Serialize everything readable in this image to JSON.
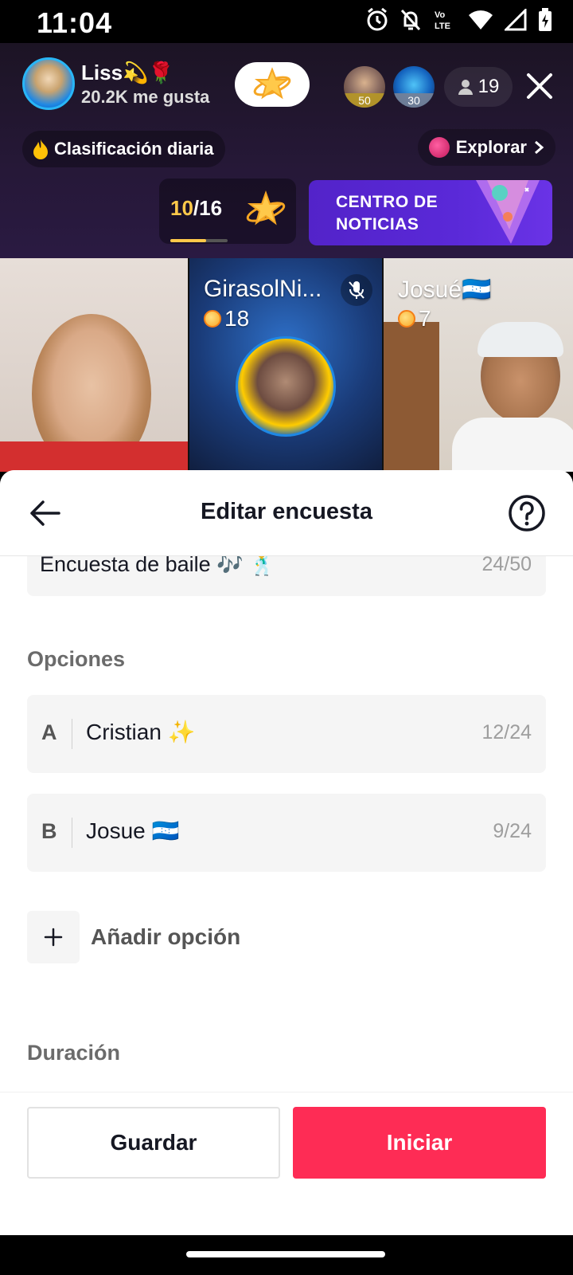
{
  "status_bar": {
    "time": "11:04",
    "network_label": "Vo LTE",
    "icons": [
      "alarm-icon",
      "notifications-off-icon",
      "volte-icon",
      "wifi-icon",
      "signal-icon",
      "battery-charging-icon"
    ]
  },
  "live": {
    "host_name": "Liss💫🌹",
    "host_likes": "20.2K me gusta",
    "top_viewers": [
      {
        "badge": "50"
      },
      {
        "badge": "30"
      }
    ],
    "viewer_count": "19",
    "daily_rank_label": "Clasificación diaria",
    "explore_label": "Explorar",
    "progress_current": "10",
    "progress_total": "/16",
    "progress_fraction": 0.625,
    "news_banner_text": "CENTRO DE NOTICIAS"
  },
  "guests": [
    {
      "name": "",
      "coins": ""
    },
    {
      "name": "GirasolNi...",
      "coins": "18"
    },
    {
      "name": "Josué🇭🇳",
      "coins": "7"
    }
  ],
  "sheet": {
    "title": "Editar encuesta",
    "question_text": "Encuesta de baile 🎶 🕺",
    "question_count": "24/50",
    "options_label": "Opciones",
    "options": [
      {
        "letter": "A",
        "text": "Cristian ✨",
        "count": "12/24"
      },
      {
        "letter": "B",
        "text": "Josue 🇭🇳",
        "count": "9/24"
      }
    ],
    "add_option_label": "Añadir opción",
    "duration_label": "Duración",
    "save_label": "Guardar",
    "start_label": "Iniciar"
  },
  "colors": {
    "primary": "#fe2c55",
    "header_bg": "#261838",
    "news_banner": "#5a29d8",
    "progress_accent": "#ffc94a"
  }
}
